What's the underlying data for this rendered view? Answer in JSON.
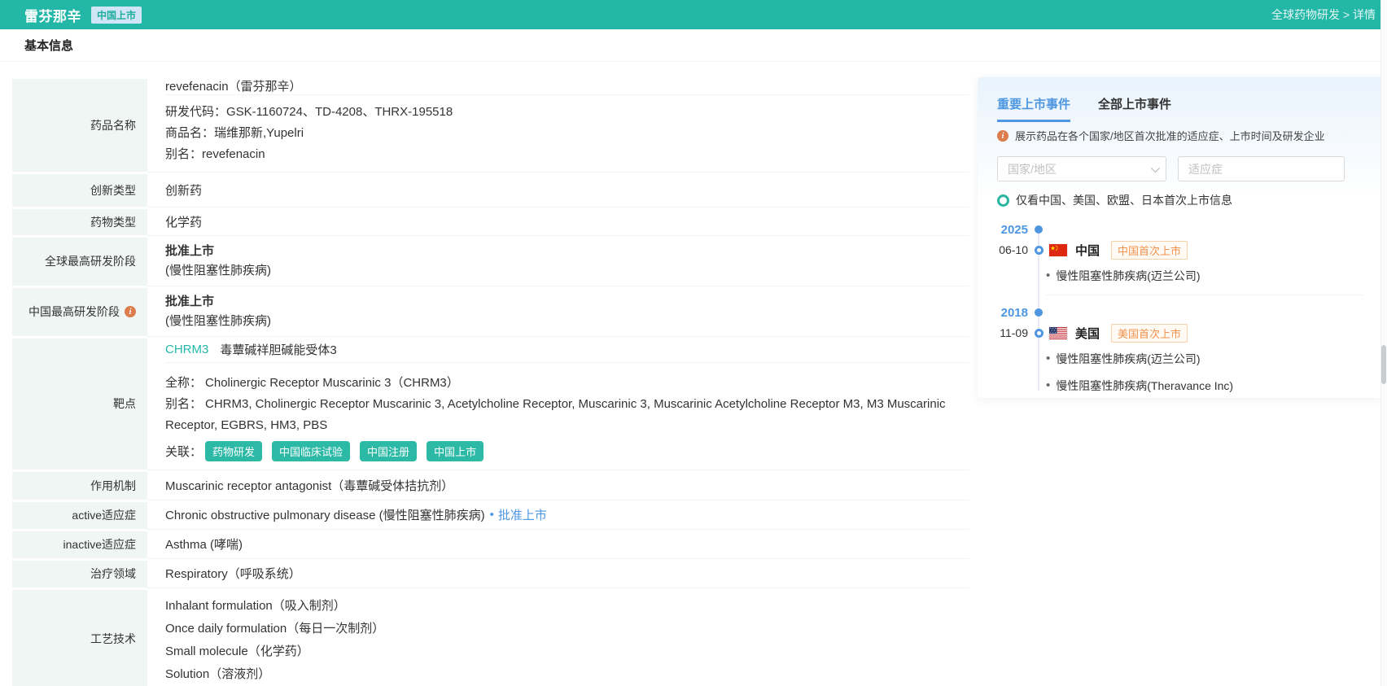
{
  "colors": {
    "teal": "#23b7a7",
    "blue": "#4e97e0",
    "orange": "#f0914d",
    "tag_teal": "#2cb9a6"
  },
  "header": {
    "title": "雷芬那辛",
    "status_badge": "中国上市",
    "breadcrumb": "全球药物研发 > 详情"
  },
  "section": {
    "title": "基本信息"
  },
  "drug": {
    "name_row": {
      "label": "药品名称",
      "primary": "revefenacin（雷芬那辛）",
      "dev_code": "研发代码：GSK-1160724、TD-4208、THRX-195518",
      "trade_name": "商品名：瑞维那新,Yupelri",
      "alias": "别名：revefenacin"
    },
    "innovation": {
      "label": "创新类型",
      "value": "创新药"
    },
    "drug_type": {
      "label": "药物类型",
      "value": "化学药"
    },
    "global_stage": {
      "label": "全球最高研发阶段",
      "stage": "批准上市",
      "indication": "(慢性阻塞性肺疾病)"
    },
    "china_stage": {
      "label": "中国最高研发阶段",
      "stage": "批准上市",
      "indication": "(慢性阻塞性肺疾病)"
    },
    "target": {
      "label": "靶点",
      "gene": "CHRM3",
      "gene_desc": "毒蕈碱祥胆碱能受体3",
      "full_name_label": "全称：",
      "full_name": "Cholinergic Receptor Muscarinic 3（CHRM3）",
      "alias_label": "别名：",
      "alias": "CHRM3, Cholinergic Receptor Muscarinic 3, Acetylcholine Receptor, Muscarinic 3, Muscarinic Acetylcholine Receptor M3, M3 Muscarinic Receptor, EGBRS, HM3, PBS",
      "relation_label": "关联：",
      "relation_tags": [
        "药物研发",
        "中国临床试验",
        "中国注册",
        "中国上市"
      ]
    },
    "moa": {
      "label": "作用机制",
      "value": "Muscarinic receptor antagonist（毒蕈碱受体拮抗剂）"
    },
    "active_indication": {
      "label": "active适应症",
      "value": "Chronic obstructive pulmonary disease (慢性阻塞性肺疾病)",
      "bullet": "•",
      "link": "批准上市"
    },
    "inactive_indication": {
      "label": "inactive适应症",
      "value": "Asthma (哮喘)"
    },
    "therapy_area": {
      "label": "治疗领域",
      "value": "Respiratory（呼吸系统）"
    },
    "technology": {
      "label": "工艺技术",
      "items": [
        "Inhalant formulation（吸入制剂）",
        "Once daily formulation（每日一次制剂）",
        "Small molecule（化学药）",
        "Solution（溶液剂）"
      ]
    }
  },
  "events": {
    "tabs": [
      {
        "label": "重要上市事件"
      },
      {
        "label": "全部上市事件"
      }
    ],
    "hint": "展示药品在各个国家/地区首次批准的适应症、上市时间及研发企业",
    "country_placeholder": "国家/地区",
    "indication_placeholder": "适应症",
    "radio_label": "仅看中国、美国、欧盟、日本首次上市信息",
    "timeline": [
      {
        "year": "2025",
        "date": "06-10",
        "country": "中国",
        "flag": "china-flag",
        "badge": "中国首次上市",
        "bullet": "•",
        "items": [
          "慢性阻塞性肺疾病(迈兰公司)"
        ]
      },
      {
        "year": "2018",
        "date": "11-09",
        "country": "美国",
        "flag": "us-flag",
        "badge": "美国首次上市",
        "bullet": "•",
        "items": [
          "慢性阻塞性肺疾病(迈兰公司)",
          "慢性阻塞性肺疾病(Theravance Inc)"
        ]
      }
    ]
  }
}
